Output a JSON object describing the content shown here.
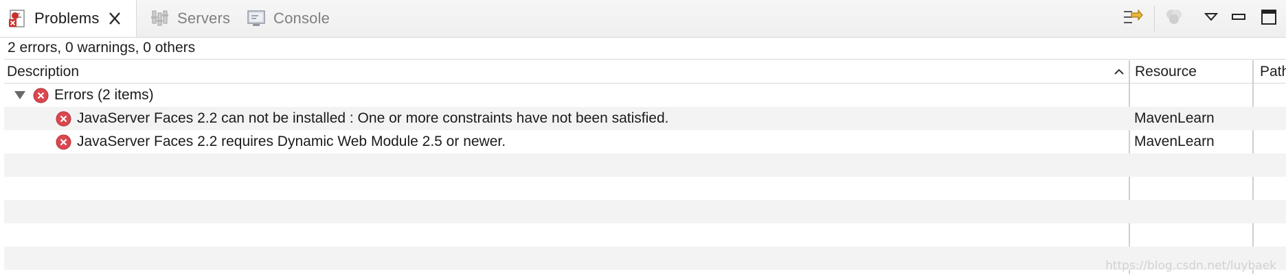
{
  "tabs": {
    "problems": {
      "label": "Problems",
      "icon": "problems-icon",
      "active": true
    },
    "servers": {
      "label": "Servers",
      "icon": "servers-icon"
    },
    "console": {
      "label": "Console",
      "icon": "console-icon"
    }
  },
  "toolbar": {
    "icons": [
      "filter-icon",
      "group-by-icon",
      "view-menu-icon",
      "minimize-icon",
      "maximize-icon"
    ]
  },
  "summary": "2 errors, 0 warnings, 0 others",
  "table": {
    "columns": [
      "Description",
      "Resource",
      "Path"
    ],
    "sort_column": "Description",
    "sort_direction": "ascending",
    "group": {
      "label": "Errors (2 items)",
      "expanded": true
    },
    "rows": [
      {
        "description": "JavaServer Faces 2.2 can not be installed : One or more constraints have not been satisfied.",
        "resource": "MavenLearn",
        "path": ""
      },
      {
        "description": "JavaServer Faces 2.2 requires Dynamic Web Module 2.5 or newer.",
        "resource": "MavenLearn",
        "path": ""
      }
    ]
  },
  "watermark": "https://blog.csdn.net/luybaek",
  "colors": {
    "error_red": "#d9474f",
    "alt_row": "#f3f3f3",
    "tab_bg": "#efefef"
  }
}
